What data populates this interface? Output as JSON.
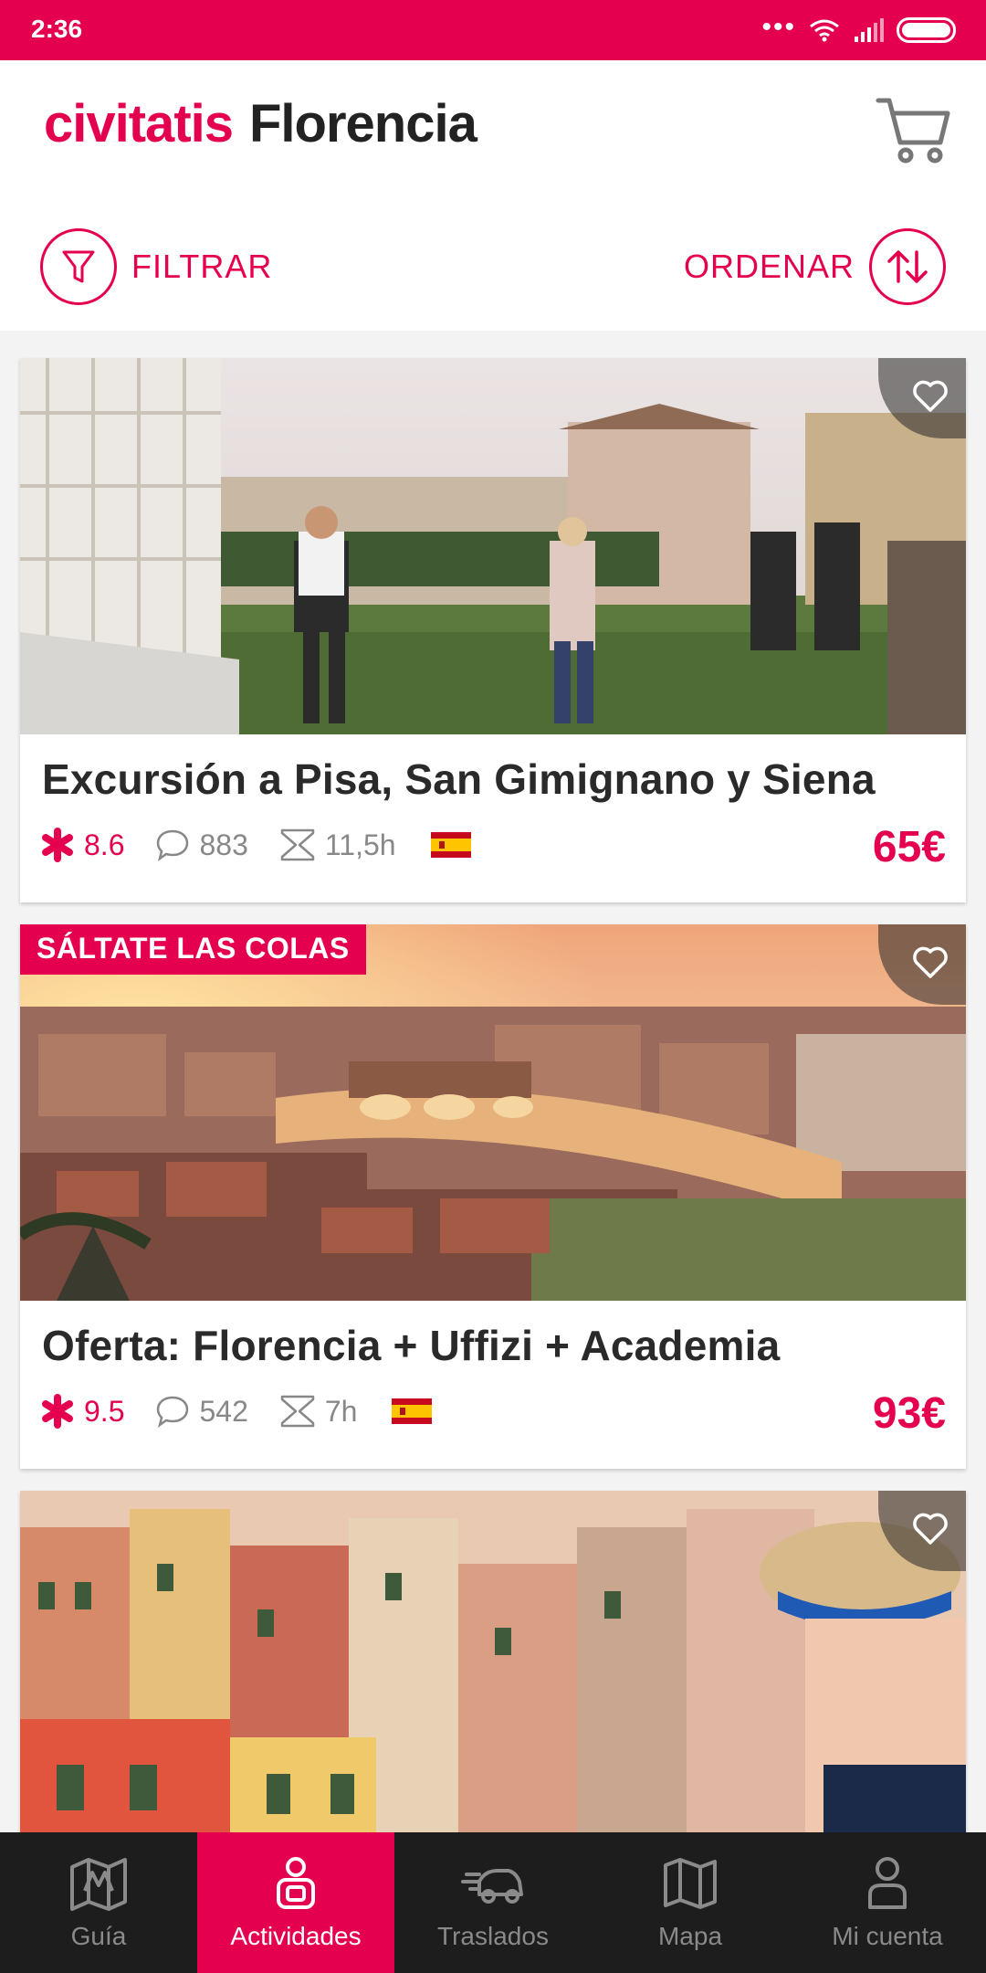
{
  "status_bar": {
    "time": "2:36",
    "icons": [
      "more-dots-icon",
      "wifi-icon",
      "signal-icon",
      "battery-icon"
    ]
  },
  "header": {
    "logo": "civitatis",
    "city": "Florencia",
    "cart_icon": "cart-icon",
    "filter_label": "FILTRAR",
    "sort_label": "ORDENAR"
  },
  "colors": {
    "accent": "#e5004f",
    "nav_bg": "#1d1d1d",
    "text": "#2a2a2a",
    "muted": "#888888"
  },
  "activities": [
    {
      "title": "Excursión a Pisa, San Gimignano y Siena",
      "rating": "8.6",
      "reviews": "883",
      "duration": "11,5h",
      "language_flag": "flag-spain-icon",
      "price": "65€",
      "badge": ""
    },
    {
      "title": "Oferta: Florencia + Uffizi + Academia",
      "rating": "9.5",
      "reviews": "542",
      "duration": "7h",
      "language_flag": "flag-spain-icon",
      "price": "93€",
      "badge": "SÁLTATE LAS COLAS"
    },
    {
      "title": "",
      "badge": ""
    }
  ],
  "bottom_nav": [
    {
      "label": "Guía",
      "icon": "map-pin-icon",
      "active": false
    },
    {
      "label": "Actividades",
      "icon": "activities-icon",
      "active": true
    },
    {
      "label": "Traslados",
      "icon": "transfer-car-icon",
      "active": false
    },
    {
      "label": "Mapa",
      "icon": "map-icon",
      "active": false
    },
    {
      "label": "Mi cuenta",
      "icon": "user-icon",
      "active": false
    }
  ]
}
